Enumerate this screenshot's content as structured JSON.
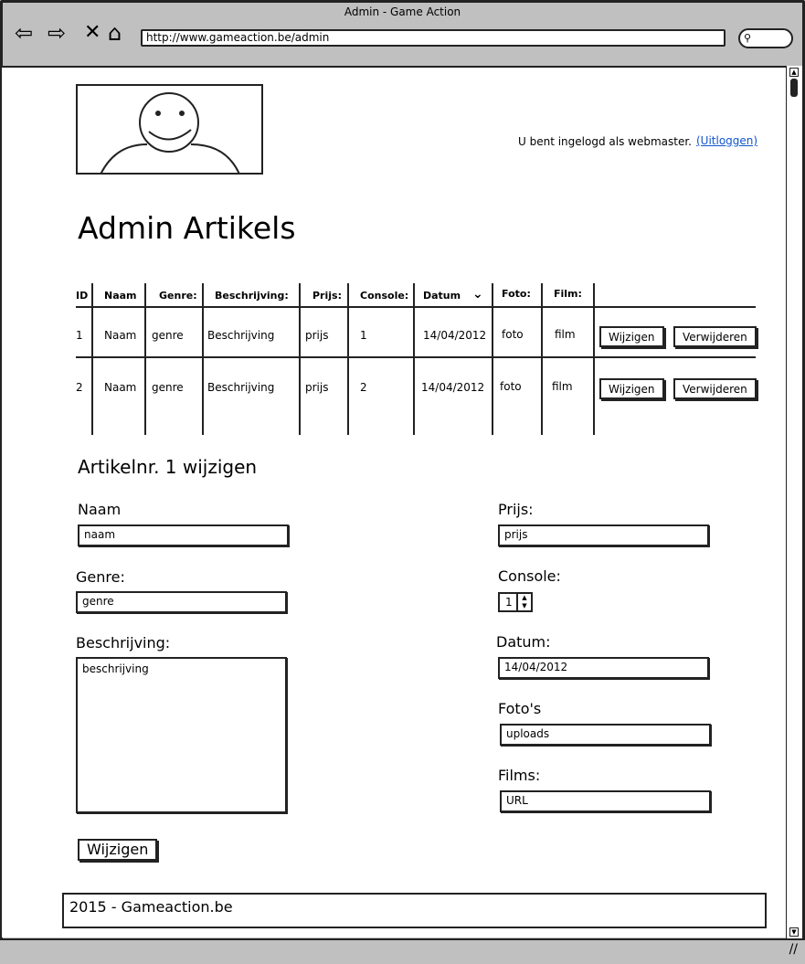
{
  "browser": {
    "title": "Admin - Game Action",
    "url": "http://www.gameaction.be/admin"
  },
  "header": {
    "login_text": "U bent ingelogd als webmaster.",
    "logout_link": "(Uitloggen)"
  },
  "page_title": "Admin Artikels",
  "table": {
    "headers": [
      "ID",
      "Naam",
      "Genre:",
      "Beschrijving:",
      "Prijs:",
      "Console:",
      "Datum",
      "Foto:",
      "Film:"
    ],
    "rows": [
      [
        "1",
        "Naam",
        "genre",
        "Beschrijving",
        "prijs",
        "1",
        "14/04/2012",
        "foto",
        "film"
      ],
      [
        "2",
        "Naam",
        "genre",
        "Beschrijving",
        "prijs",
        "2",
        "14/04/2012",
        "foto",
        "film"
      ]
    ],
    "edit_label": "Wijzigen",
    "delete_label": "Verwijderen"
  },
  "form": {
    "title": "Artikelnr. 1 wijzigen",
    "naam_label": "Naam",
    "naam_value": "naam",
    "genre_label": "Genre:",
    "genre_value": "genre",
    "beschrijving_label": "Beschrijving:",
    "beschrijving_value": "beschrijving",
    "prijs_label": "Prijs:",
    "prijs_value": "prijs",
    "console_label": "Console:",
    "console_value": "1",
    "datum_label": "Datum:",
    "datum_value": "14/04/2012",
    "fotos_label": "Foto's",
    "fotos_value": "uploads",
    "films_label": "Films:",
    "films_value": "URL",
    "submit_label": "Wijzigen"
  },
  "footer": {
    "text": "2015 - Gameaction.be"
  }
}
